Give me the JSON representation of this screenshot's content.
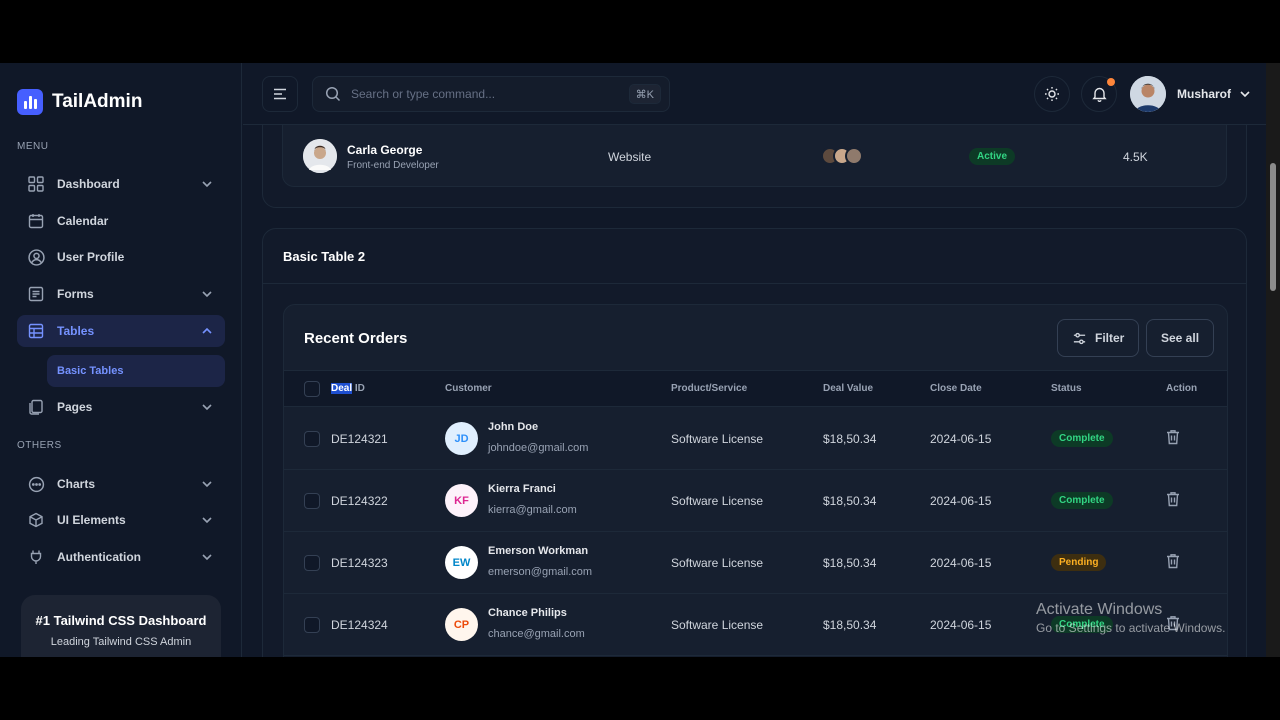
{
  "app": {
    "name": "TailAdmin"
  },
  "colors": {
    "accent": "#465fff",
    "background": "#101828",
    "success": "#32d583",
    "warning": "#fdb022"
  },
  "sidebar": {
    "menu_label": "MENU",
    "others_label": "OTHERS",
    "items": [
      {
        "label": "Dashboard",
        "icon": "grid-icon",
        "has_chevron": true
      },
      {
        "label": "Calendar",
        "icon": "calendar-icon",
        "has_chevron": false
      },
      {
        "label": "User Profile",
        "icon": "user-circle-icon",
        "has_chevron": false
      },
      {
        "label": "Forms",
        "icon": "form-icon",
        "has_chevron": true
      },
      {
        "label": "Tables",
        "icon": "table-icon",
        "has_chevron": true,
        "active": true
      },
      {
        "label": "Pages",
        "icon": "pages-icon",
        "has_chevron": true
      }
    ],
    "sub_items": [
      {
        "label": "Basic Tables",
        "active": true
      }
    ],
    "others": [
      {
        "label": "Charts",
        "icon": "chart-chat-icon"
      },
      {
        "label": "UI Elements",
        "icon": "cube-icon"
      },
      {
        "label": "Authentication",
        "icon": "plug-icon"
      }
    ],
    "promo": {
      "title": "#1 Tailwind CSS Dashboard",
      "text": "Leading Tailwind CSS Admin"
    }
  },
  "header": {
    "search_placeholder": "Search or type command...",
    "shortcut": "⌘K",
    "user_name": "Musharof"
  },
  "previous_table": {
    "row": {
      "name": "Carla George",
      "role": "Front-end Developer",
      "project": "Website",
      "status": "Active",
      "budget": "4.5K"
    }
  },
  "basic_table_2": {
    "title": "Basic Table 2",
    "card_title": "Recent Orders",
    "filter_label": "Filter",
    "see_all_label": "See all",
    "columns": {
      "deal_highlight": "Deal",
      "deal_rest": " ID",
      "customer": "Customer",
      "product": "Product/Service",
      "value": "Deal Value",
      "close": "Close Date",
      "status": "Status",
      "action": "Action"
    },
    "rows": [
      {
        "id": "DE124321",
        "initials": "JD",
        "name": "John Doe",
        "email": "johndoe@gmail.com",
        "product": "Software License",
        "value": "$18,50.34",
        "date": "2024-06-15",
        "status": "Complete",
        "status_type": "complete",
        "avatar_bg": "#e0effe",
        "avatar_fg": "#2e90fa"
      },
      {
        "id": "DE124322",
        "initials": "KF",
        "name": "Kierra Franci",
        "email": "kierra@gmail.com",
        "product": "Software License",
        "value": "$18,50.34",
        "date": "2024-06-15",
        "status": "Complete",
        "status_type": "complete",
        "avatar_bg": "#fdf2fa",
        "avatar_fg": "#dd2590"
      },
      {
        "id": "DE124323",
        "initials": "EW",
        "name": "Emerson Workman",
        "email": "emerson@gmail.com",
        "product": "Software License",
        "value": "$18,50.34",
        "date": "2024-06-15",
        "status": "Pending",
        "status_type": "pending",
        "avatar_bg": "#ffffff",
        "avatar_fg": "#0086c9"
      },
      {
        "id": "DE124324",
        "initials": "CP",
        "name": "Chance Philips",
        "email": "chance@gmail.com",
        "product": "Software License",
        "value": "$18,50.34",
        "date": "2024-06-15",
        "status": "Complete",
        "status_type": "complete",
        "avatar_bg": "#fff6ed",
        "avatar_fg": "#ec4a0a"
      }
    ]
  },
  "watermark": {
    "line1": "Activate Windows",
    "line2": "Go to Settings to activate Windows."
  }
}
